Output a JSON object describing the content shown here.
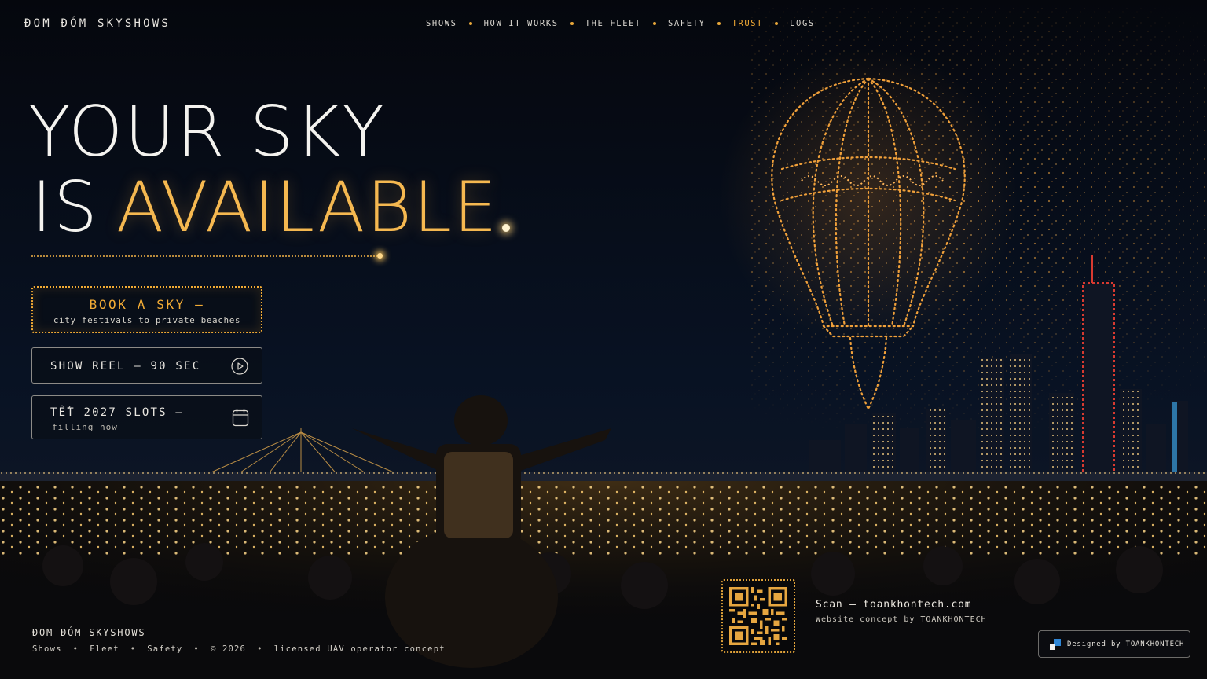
{
  "header": {
    "brand": "ĐOM ĐÓM SKYSHOWS",
    "nav": [
      {
        "label": "SHOWS"
      },
      {
        "label": "HOW IT WORKS"
      },
      {
        "label": "THE FLEET"
      },
      {
        "label": "SAFETY"
      },
      {
        "label": "TRUST"
      },
      {
        "label": "LOGS"
      }
    ],
    "active_nav": "TRUST"
  },
  "hero": {
    "line1": "YOUR SKY",
    "line2_word1": "IS",
    "line2_word2": "AVAILABLE"
  },
  "cta": {
    "book_title": "BOOK A SKY —",
    "book_sub": "city festivals to private beaches",
    "reel_label": "SHOW REEL — 90 SEC",
    "reel_icon": "play-circle-icon",
    "tet_title": "TẾT 2027 SLOTS —",
    "tet_sub": "filling now",
    "tet_icon": "calendar-icon"
  },
  "footer": {
    "brand": "ĐOM ĐÓM SKYSHOWS —",
    "links": [
      "Shows",
      "Fleet",
      "Safety",
      "© 2026",
      "licensed UAV operator concept"
    ],
    "scan_text": "Scan — toankhontech.com",
    "scan_sub": "Website concept by TOANKHONTECH",
    "badge": "Designed by TOANKHONTECH"
  },
  "colors": {
    "accent": "#f2ab35",
    "background": "#05070c",
    "text": "#f4f3ef"
  }
}
